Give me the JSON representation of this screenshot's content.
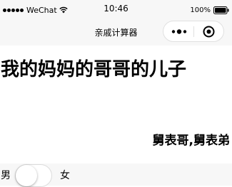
{
  "status_bar": {
    "carrier": "WeChat",
    "time": "10:46",
    "battery": "100%"
  },
  "nav": {
    "title": "亲戚计算器"
  },
  "main": {
    "relation": "我的妈妈的哥哥的儿子",
    "result": "舅表哥,舅表弟"
  },
  "bottom": {
    "male_label": "男",
    "female_label": "女",
    "gender_switch_on": false
  },
  "icons": {
    "signal": "signal-dots-icon",
    "wifi": "wifi-icon",
    "battery": "battery-icon",
    "more": "more-icon",
    "close": "capsule-close-icon"
  }
}
